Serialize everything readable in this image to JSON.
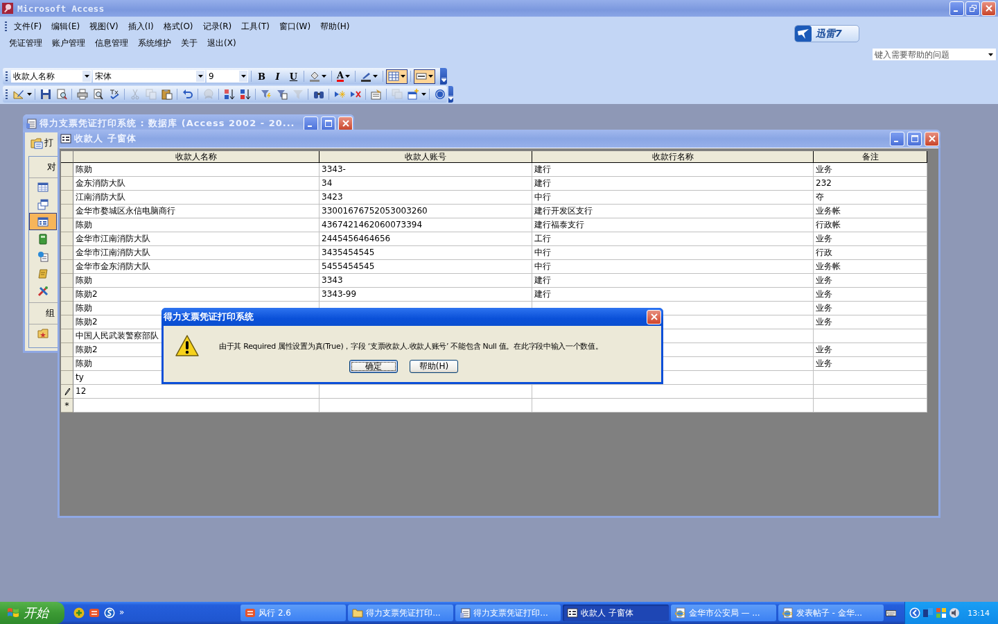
{
  "app": {
    "title": "Microsoft Access"
  },
  "menu_bar": [
    {
      "label": "文件(F)"
    },
    {
      "label": "编辑(E)"
    },
    {
      "label": "视图(V)"
    },
    {
      "label": "插入(I)"
    },
    {
      "label": "格式(O)"
    },
    {
      "label": "记录(R)"
    },
    {
      "label": "工具(T)"
    },
    {
      "label": "窗口(W)"
    },
    {
      "label": "帮助(H)"
    }
  ],
  "custom_menu": [
    {
      "label": "凭证管理"
    },
    {
      "label": "账户管理"
    },
    {
      "label": "信息管理"
    },
    {
      "label": "系统维护"
    },
    {
      "label": "关于"
    },
    {
      "label": "退出(X)"
    }
  ],
  "xunlei": {
    "label": "迅雷7"
  },
  "help_box": {
    "placeholder": "键入需要帮助的问题"
  },
  "format_toolbar": {
    "object": "收款人名称",
    "font": "宋体",
    "size": "9",
    "tools": [
      {
        "kind": "bold",
        "label": "B",
        "selected": false
      },
      {
        "kind": "italic",
        "label": "I",
        "selected": false
      },
      {
        "kind": "underline",
        "label": "U",
        "selected": false
      },
      {
        "kind": "fill",
        "selected": false
      },
      {
        "kind": "fontcolor",
        "label": "A",
        "selected": false
      },
      {
        "kind": "linecolor",
        "selected": false
      },
      {
        "kind": "gridlines",
        "selected": true
      },
      {
        "kind": "border",
        "selected": true
      }
    ]
  },
  "standard_toolbar": [
    [
      {
        "kind": "design",
        "disabled": false
      }
    ],
    [
      {
        "kind": "save",
        "disabled": false
      },
      {
        "kind": "search",
        "disabled": false
      }
    ],
    [
      {
        "kind": "print",
        "disabled": false
      },
      {
        "kind": "preview",
        "disabled": false
      },
      {
        "kind": "spell",
        "disabled": false
      }
    ],
    [
      {
        "kind": "cut",
        "disabled": true
      },
      {
        "kind": "copy",
        "disabled": true
      },
      {
        "kind": "paste",
        "disabled": false
      }
    ],
    [
      {
        "kind": "undo",
        "disabled": false
      }
    ],
    [
      {
        "kind": "hyperlink",
        "disabled": true
      }
    ],
    [
      {
        "kind": "sortasc",
        "disabled": false
      },
      {
        "kind": "sortdesc",
        "disabled": false
      }
    ],
    [
      {
        "kind": "filtersel",
        "disabled": false
      },
      {
        "kind": "filterform",
        "disabled": false
      },
      {
        "kind": "filterapply",
        "disabled": true
      }
    ],
    [
      {
        "kind": "find",
        "disabled": false
      }
    ],
    [
      {
        "kind": "newrec",
        "disabled": false
      },
      {
        "kind": "delrec",
        "disabled": false
      }
    ],
    [
      {
        "kind": "props",
        "disabled": false
      }
    ],
    [
      {
        "kind": "dbwin",
        "disabled": true
      },
      {
        "kind": "newobj",
        "disabled": false
      }
    ],
    [
      {
        "kind": "help",
        "disabled": false
      }
    ]
  ],
  "database_window": {
    "title": "得力支票凭证打印系统 : 数据库 (Access 2002 - 20...",
    "open_label": "打",
    "objects_label": "对",
    "objects": [
      {
        "kind": "table",
        "selected": false
      },
      {
        "kind": "query",
        "selected": false
      },
      {
        "kind": "form",
        "selected": true
      },
      {
        "kind": "report",
        "selected": false
      },
      {
        "kind": "page",
        "selected": false
      },
      {
        "kind": "macro",
        "selected": false
      },
      {
        "kind": "module",
        "selected": false
      }
    ],
    "groups_label": "组",
    "groups": [
      {
        "kind": "favorites",
        "selected": false
      }
    ]
  },
  "subform": {
    "title": "收款人 子窗体",
    "columns": [
      "收款人名称",
      "收款人账号",
      "收款行名称",
      "备注"
    ],
    "rows": [
      {
        "cells": [
          "陈勋",
          "3343-",
          "建行",
          "业务"
        ]
      },
      {
        "cells": [
          "金东消防大队",
          "34",
          "建行",
          "232"
        ]
      },
      {
        "cells": [
          "江南消防大队",
          "3423",
          "中行",
          "夺"
        ]
      },
      {
        "cells": [
          "金华市婺城区永信电脑商行",
          "33001676752053003260",
          "建行开发区支行",
          "业务帐"
        ]
      },
      {
        "cells": [
          "陈勋",
          "4367421462060073394",
          "建行福泰支行",
          "行政帐"
        ]
      },
      {
        "cells": [
          "金华市江南消防大队",
          "2445456464656",
          "工行",
          "业务"
        ]
      },
      {
        "cells": [
          "金华市江南消防大队",
          "3435454545",
          "中行",
          "行政"
        ]
      },
      {
        "cells": [
          "金华市金东消防大队",
          "5455454545",
          "中行",
          "业务帐"
        ]
      },
      {
        "cells": [
          "陈勋",
          "3343",
          "建行",
          "业务"
        ]
      },
      {
        "cells": [
          "陈勋2",
          "3343-99",
          "建行",
          "业务"
        ]
      },
      {
        "cells": [
          "陈勋",
          null,
          null,
          "业务"
        ]
      },
      {
        "cells": [
          "陈勋2",
          null,
          null,
          "业务"
        ]
      },
      {
        "cells": [
          "中国人民武装警察部队",
          null,
          null,
          null
        ]
      },
      {
        "cells": [
          "陈勋2",
          null,
          null,
          "业务"
        ]
      },
      {
        "cells": [
          "陈勋",
          null,
          null,
          "业务"
        ]
      },
      {
        "cells": [
          "ty",
          null,
          null,
          null
        ]
      },
      {
        "cells": [
          "12",
          null,
          null,
          null
        ],
        "editing": true
      }
    ],
    "new_row_marker": "*"
  },
  "dialog": {
    "title": "得力支票凭证打印系统",
    "message": "由于其 Required 属性设置为真(True)，字段 ‘支票收款人.收款人账号’ 不能包含 Null 值。在此字段中输入一个数值。",
    "buttons": [
      {
        "label": "确定",
        "selected": true
      },
      {
        "label": "帮助(H)",
        "selected": false
      }
    ]
  },
  "taskbar": {
    "start": "开始",
    "more": "»",
    "tasks": [
      {
        "kind": "app",
        "label": "风行 2.6",
        "selected": false
      },
      {
        "kind": "folder",
        "label": "得力支票凭证打印...",
        "selected": false
      },
      {
        "kind": "database",
        "label": "得力支票凭证打印...",
        "selected": false
      },
      {
        "kind": "form",
        "label": "收款人 子窗体",
        "selected": true
      },
      {
        "kind": "browser",
        "label": "金华市公安局 — ...",
        "selected": false
      },
      {
        "kind": "browser",
        "label": "发表帖子 - 金华...",
        "selected": false
      }
    ],
    "clock": "13:14"
  }
}
